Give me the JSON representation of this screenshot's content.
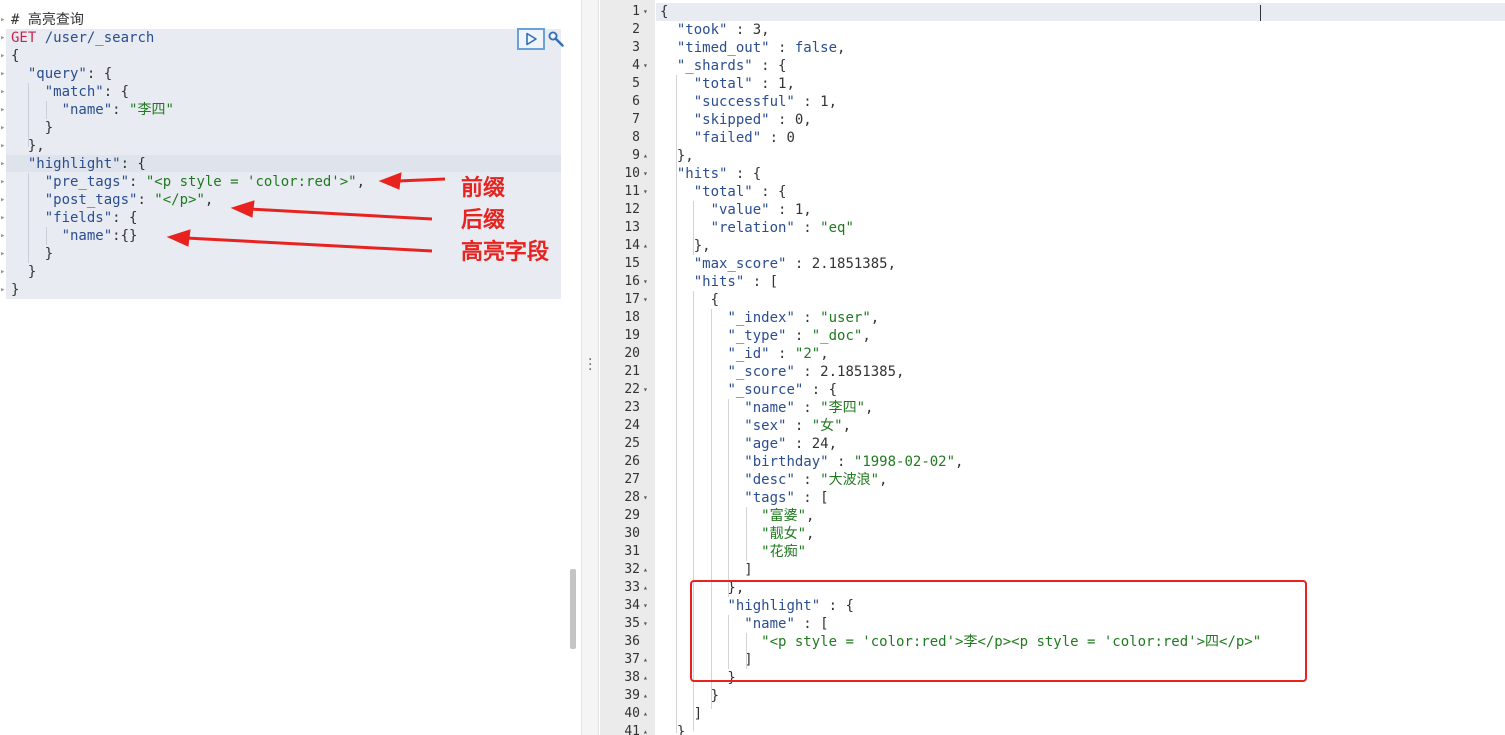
{
  "left_editor": {
    "lines": [
      {
        "id": "l1",
        "parts": [
          {
            "t": "# 高亮查询",
            "c": "comment"
          }
        ]
      },
      {
        "id": "l2",
        "parts": [
          {
            "t": "GET",
            "c": "method"
          },
          {
            "t": " /user/_search",
            "c": "url"
          }
        ]
      },
      {
        "id": "l3",
        "parts": [
          {
            "t": "{",
            "c": "punc"
          }
        ]
      },
      {
        "id": "l4",
        "parts": [
          {
            "t": "  ",
            "c": "punc"
          },
          {
            "t": "\"query\"",
            "c": "key"
          },
          {
            "t": ": {",
            "c": "punc"
          }
        ]
      },
      {
        "id": "l5",
        "parts": [
          {
            "t": "    ",
            "c": "punc"
          },
          {
            "t": "\"match\"",
            "c": "key"
          },
          {
            "t": ": {",
            "c": "punc"
          }
        ]
      },
      {
        "id": "l6",
        "parts": [
          {
            "t": "      ",
            "c": "punc"
          },
          {
            "t": "\"name\"",
            "c": "key"
          },
          {
            "t": ": ",
            "c": "punc"
          },
          {
            "t": "\"李四\"",
            "c": "str"
          }
        ]
      },
      {
        "id": "l7",
        "parts": [
          {
            "t": "    }",
            "c": "punc"
          }
        ]
      },
      {
        "id": "l8",
        "parts": [
          {
            "t": "  },",
            "c": "punc"
          }
        ]
      },
      {
        "id": "l9",
        "parts": [
          {
            "t": "  ",
            "c": "punc"
          },
          {
            "t": "\"highlight\"",
            "c": "key"
          },
          {
            "t": ": {",
            "c": "punc"
          }
        ]
      },
      {
        "id": "l10",
        "parts": [
          {
            "t": "    ",
            "c": "punc"
          },
          {
            "t": "\"pre_tags\"",
            "c": "key"
          },
          {
            "t": ": ",
            "c": "punc"
          },
          {
            "t": "\"<p style = 'color:red'>\"",
            "c": "str"
          },
          {
            "t": ",",
            "c": "punc"
          }
        ]
      },
      {
        "id": "l11",
        "parts": [
          {
            "t": "    ",
            "c": "punc"
          },
          {
            "t": "\"post_tags\"",
            "c": "key"
          },
          {
            "t": ": ",
            "c": "punc"
          },
          {
            "t": "\"</p>\"",
            "c": "str"
          },
          {
            "t": ",",
            "c": "punc"
          }
        ]
      },
      {
        "id": "l12",
        "parts": [
          {
            "t": "    ",
            "c": "punc"
          },
          {
            "t": "\"fields\"",
            "c": "key"
          },
          {
            "t": ": {",
            "c": "punc"
          }
        ]
      },
      {
        "id": "l13",
        "parts": [
          {
            "t": "      ",
            "c": "punc"
          },
          {
            "t": "\"name\"",
            "c": "key"
          },
          {
            "t": ":{}",
            "c": "punc"
          }
        ]
      },
      {
        "id": "l14",
        "parts": [
          {
            "t": "    }",
            "c": "punc"
          }
        ]
      },
      {
        "id": "l15",
        "parts": [
          {
            "t": "  }",
            "c": "punc"
          }
        ]
      },
      {
        "id": "l16",
        "parts": [
          {
            "t": "}",
            "c": "punc"
          }
        ]
      }
    ]
  },
  "annotations": {
    "prefix": "前缀",
    "suffix": "后缀",
    "highlight_field": "高亮字段"
  },
  "right_editor": {
    "lines": [
      {
        "n": "1",
        "parts": [
          {
            "t": "{",
            "c": "punc"
          }
        ]
      },
      {
        "n": "2",
        "parts": [
          {
            "t": "  ",
            "c": "punc"
          },
          {
            "t": "\"took\"",
            "c": "key"
          },
          {
            "t": " : 3,",
            "c": "punc"
          }
        ]
      },
      {
        "n": "3",
        "parts": [
          {
            "t": "  ",
            "c": "punc"
          },
          {
            "t": "\"timed_out\"",
            "c": "key"
          },
          {
            "t": " : ",
            "c": "punc"
          },
          {
            "t": "false",
            "c": "key"
          },
          {
            "t": ",",
            "c": "punc"
          }
        ]
      },
      {
        "n": "4",
        "parts": [
          {
            "t": "  ",
            "c": "punc"
          },
          {
            "t": "\"_shards\"",
            "c": "key"
          },
          {
            "t": " : {",
            "c": "punc"
          }
        ]
      },
      {
        "n": "5",
        "parts": [
          {
            "t": "    ",
            "c": "punc"
          },
          {
            "t": "\"total\"",
            "c": "key"
          },
          {
            "t": " : 1,",
            "c": "punc"
          }
        ]
      },
      {
        "n": "6",
        "parts": [
          {
            "t": "    ",
            "c": "punc"
          },
          {
            "t": "\"successful\"",
            "c": "key"
          },
          {
            "t": " : 1,",
            "c": "punc"
          }
        ]
      },
      {
        "n": "7",
        "parts": [
          {
            "t": "    ",
            "c": "punc"
          },
          {
            "t": "\"skipped\"",
            "c": "key"
          },
          {
            "t": " : 0,",
            "c": "punc"
          }
        ]
      },
      {
        "n": "8",
        "parts": [
          {
            "t": "    ",
            "c": "punc"
          },
          {
            "t": "\"failed\"",
            "c": "key"
          },
          {
            "t": " : 0",
            "c": "punc"
          }
        ]
      },
      {
        "n": "9",
        "parts": [
          {
            "t": "  },",
            "c": "punc"
          }
        ]
      },
      {
        "n": "10",
        "parts": [
          {
            "t": "  ",
            "c": "punc"
          },
          {
            "t": "\"hits\"",
            "c": "key"
          },
          {
            "t": " : {",
            "c": "punc"
          }
        ]
      },
      {
        "n": "11",
        "parts": [
          {
            "t": "    ",
            "c": "punc"
          },
          {
            "t": "\"total\"",
            "c": "key"
          },
          {
            "t": " : {",
            "c": "punc"
          }
        ]
      },
      {
        "n": "12",
        "parts": [
          {
            "t": "      ",
            "c": "punc"
          },
          {
            "t": "\"value\"",
            "c": "key"
          },
          {
            "t": " : 1,",
            "c": "punc"
          }
        ]
      },
      {
        "n": "13",
        "parts": [
          {
            "t": "      ",
            "c": "punc"
          },
          {
            "t": "\"relation\"",
            "c": "key"
          },
          {
            "t": " : ",
            "c": "punc"
          },
          {
            "t": "\"eq\"",
            "c": "str"
          }
        ]
      },
      {
        "n": "14",
        "parts": [
          {
            "t": "    },",
            "c": "punc"
          }
        ]
      },
      {
        "n": "15",
        "parts": [
          {
            "t": "    ",
            "c": "punc"
          },
          {
            "t": "\"max_score\"",
            "c": "key"
          },
          {
            "t": " : 2.1851385,",
            "c": "punc"
          }
        ]
      },
      {
        "n": "16",
        "parts": [
          {
            "t": "    ",
            "c": "punc"
          },
          {
            "t": "\"hits\"",
            "c": "key"
          },
          {
            "t": " : [",
            "c": "punc"
          }
        ]
      },
      {
        "n": "17",
        "parts": [
          {
            "t": "      {",
            "c": "punc"
          }
        ]
      },
      {
        "n": "18",
        "parts": [
          {
            "t": "        ",
            "c": "punc"
          },
          {
            "t": "\"_index\"",
            "c": "key"
          },
          {
            "t": " : ",
            "c": "punc"
          },
          {
            "t": "\"user\"",
            "c": "str"
          },
          {
            "t": ",",
            "c": "punc"
          }
        ]
      },
      {
        "n": "19",
        "parts": [
          {
            "t": "        ",
            "c": "punc"
          },
          {
            "t": "\"_type\"",
            "c": "key"
          },
          {
            "t": " : ",
            "c": "punc"
          },
          {
            "t": "\"_doc\"",
            "c": "str"
          },
          {
            "t": ",",
            "c": "punc"
          }
        ]
      },
      {
        "n": "20",
        "parts": [
          {
            "t": "        ",
            "c": "punc"
          },
          {
            "t": "\"_id\"",
            "c": "key"
          },
          {
            "t": " : ",
            "c": "punc"
          },
          {
            "t": "\"2\"",
            "c": "str"
          },
          {
            "t": ",",
            "c": "punc"
          }
        ]
      },
      {
        "n": "21",
        "parts": [
          {
            "t": "        ",
            "c": "punc"
          },
          {
            "t": "\"_score\"",
            "c": "key"
          },
          {
            "t": " : 2.1851385,",
            "c": "punc"
          }
        ]
      },
      {
        "n": "22",
        "parts": [
          {
            "t": "        ",
            "c": "punc"
          },
          {
            "t": "\"_source\"",
            "c": "key"
          },
          {
            "t": " : {",
            "c": "punc"
          }
        ]
      },
      {
        "n": "23",
        "parts": [
          {
            "t": "          ",
            "c": "punc"
          },
          {
            "t": "\"name\"",
            "c": "key"
          },
          {
            "t": " : ",
            "c": "punc"
          },
          {
            "t": "\"李四\"",
            "c": "str"
          },
          {
            "t": ",",
            "c": "punc"
          }
        ]
      },
      {
        "n": "24",
        "parts": [
          {
            "t": "          ",
            "c": "punc"
          },
          {
            "t": "\"sex\"",
            "c": "key"
          },
          {
            "t": " : ",
            "c": "punc"
          },
          {
            "t": "\"女\"",
            "c": "str"
          },
          {
            "t": ",",
            "c": "punc"
          }
        ]
      },
      {
        "n": "25",
        "parts": [
          {
            "t": "          ",
            "c": "punc"
          },
          {
            "t": "\"age\"",
            "c": "key"
          },
          {
            "t": " : 24,",
            "c": "punc"
          }
        ]
      },
      {
        "n": "26",
        "parts": [
          {
            "t": "          ",
            "c": "punc"
          },
          {
            "t": "\"birthday\"",
            "c": "key"
          },
          {
            "t": " : ",
            "c": "punc"
          },
          {
            "t": "\"1998-02-02\"",
            "c": "str"
          },
          {
            "t": ",",
            "c": "punc"
          }
        ]
      },
      {
        "n": "27",
        "parts": [
          {
            "t": "          ",
            "c": "punc"
          },
          {
            "t": "\"desc\"",
            "c": "key"
          },
          {
            "t": " : ",
            "c": "punc"
          },
          {
            "t": "\"大波浪\"",
            "c": "str"
          },
          {
            "t": ",",
            "c": "punc"
          }
        ]
      },
      {
        "n": "28",
        "parts": [
          {
            "t": "          ",
            "c": "punc"
          },
          {
            "t": "\"tags\"",
            "c": "key"
          },
          {
            "t": " : [",
            "c": "punc"
          }
        ]
      },
      {
        "n": "29",
        "parts": [
          {
            "t": "            ",
            "c": "punc"
          },
          {
            "t": "\"富婆\"",
            "c": "str"
          },
          {
            "t": ",",
            "c": "punc"
          }
        ]
      },
      {
        "n": "30",
        "parts": [
          {
            "t": "            ",
            "c": "punc"
          },
          {
            "t": "\"靓女\"",
            "c": "str"
          },
          {
            "t": ",",
            "c": "punc"
          }
        ]
      },
      {
        "n": "31",
        "parts": [
          {
            "t": "            ",
            "c": "punc"
          },
          {
            "t": "\"花痴\"",
            "c": "str"
          }
        ]
      },
      {
        "n": "32",
        "parts": [
          {
            "t": "          ]",
            "c": "punc"
          }
        ]
      },
      {
        "n": "33",
        "parts": [
          {
            "t": "        },",
            "c": "punc"
          }
        ]
      },
      {
        "n": "34",
        "parts": [
          {
            "t": "        ",
            "c": "punc"
          },
          {
            "t": "\"highlight\"",
            "c": "key"
          },
          {
            "t": " : {",
            "c": "punc"
          }
        ]
      },
      {
        "n": "35",
        "parts": [
          {
            "t": "          ",
            "c": "punc"
          },
          {
            "t": "\"name\"",
            "c": "key"
          },
          {
            "t": " : [",
            "c": "punc"
          }
        ]
      },
      {
        "n": "36",
        "parts": [
          {
            "t": "            ",
            "c": "punc"
          },
          {
            "t": "\"<p style = 'color:red'>李</p><p style = 'color:red'>四</p>\"",
            "c": "str"
          }
        ]
      },
      {
        "n": "37",
        "parts": [
          {
            "t": "          ]",
            "c": "punc"
          }
        ]
      },
      {
        "n": "38",
        "parts": [
          {
            "t": "        }",
            "c": "punc"
          }
        ]
      },
      {
        "n": "39",
        "parts": [
          {
            "t": "      }",
            "c": "punc"
          }
        ]
      },
      {
        "n": "40",
        "parts": [
          {
            "t": "    ]",
            "c": "punc"
          }
        ]
      },
      {
        "n": "41",
        "parts": [
          {
            "t": "  }",
            "c": "punc"
          }
        ]
      }
    ]
  },
  "colors": {
    "key": "#2a4e8f",
    "string": "#207a20",
    "method": "#c7254e",
    "annotation": "#e8231f"
  }
}
